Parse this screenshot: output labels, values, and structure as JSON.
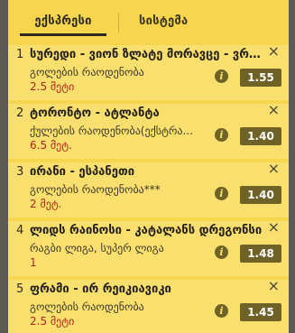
{
  "tabs": {
    "express": "ექსპრესი",
    "system": "სისტემა"
  },
  "bets": [
    {
      "index": "1",
      "title": "სურედი - ვიონ ზლატე მორავცე - ვრაბ...",
      "market": "გოლების რაოდენობა",
      "pick": "2.5 მეტი",
      "odds": "1.55"
    },
    {
      "index": "2",
      "title": "ტორონტო - ატლანტა",
      "market": "ქულების რაოდენობა(ექსტრა...",
      "pick": "6.5 მეტ.",
      "odds": "1.40"
    },
    {
      "index": "3",
      "title": "ირანი - ესპანეთი",
      "market": "გოლების რაოდენობა***",
      "pick": "2 მეტ.",
      "odds": "1.40"
    },
    {
      "index": "4",
      "title": "ლიდს რაინოსი - კატალანს დრეგონსი",
      "market": "რაგბი ლიგა, სუპერ ლიგა",
      "pick": "1",
      "odds": "1.48"
    },
    {
      "index": "5",
      "title": "ფრამი - ირ რეიკიავიკი",
      "market": "გოლების რაოდენობა",
      "pick": "2.5 მეტი",
      "odds": "1.45"
    }
  ],
  "icons": {
    "close": "close-icon",
    "info": "info-icon"
  },
  "colors": {
    "panel": "#f7d64e",
    "card": "#f9df6d",
    "odds_bg": "#6e6226",
    "pick_text": "#b3251c"
  }
}
